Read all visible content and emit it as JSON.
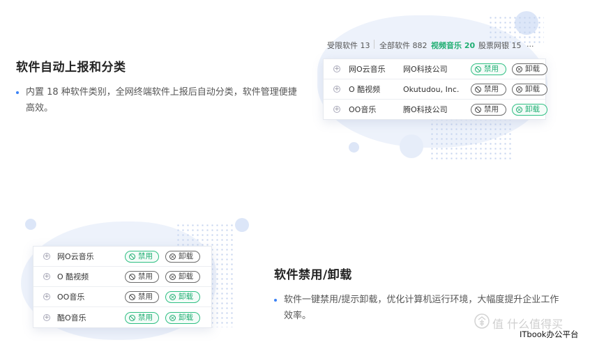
{
  "section1": {
    "heading": "软件自动上报和分类",
    "description": "内置 18 种软件类别，全网终端软件上报后自动分类，软件管理便捷高效。",
    "tabs": [
      {
        "label": "受限软件 13",
        "active": false
      },
      {
        "label": "全部软件 882",
        "active": false
      },
      {
        "label": "视频音乐 20",
        "active": true
      },
      {
        "label": "股票网银 15",
        "active": false
      },
      {
        "label": "...",
        "active": false
      }
    ],
    "rows": [
      {
        "name": "网O云音乐",
        "vendor": "网O科技公司",
        "disable": "禁用",
        "uninstall": "卸载",
        "disable_active": true,
        "uninstall_active": false
      },
      {
        "name": "O 酷视频",
        "vendor": "Okutudou, Inc.",
        "disable": "禁用",
        "uninstall": "卸载",
        "disable_active": false,
        "uninstall_active": false
      },
      {
        "name": "OO音乐",
        "vendor": "腾O科技公司",
        "disable": "禁用",
        "uninstall": "卸载",
        "disable_active": false,
        "uninstall_active": true
      }
    ]
  },
  "section2": {
    "heading": "软件禁用/卸载",
    "description": "软件一键禁用/提示卸载，优化计算机运行环境，大幅度提升企业工作效率。",
    "rows": [
      {
        "name": "网O云音乐",
        "disable": "禁用",
        "uninstall": "卸载",
        "disable_active": true,
        "uninstall_active": false
      },
      {
        "name": "O 酷视频",
        "disable": "禁用",
        "uninstall": "卸载",
        "disable_active": false,
        "uninstall_active": false
      },
      {
        "name": "OO音乐",
        "disable": "禁用",
        "uninstall": "卸载",
        "disable_active": false,
        "uninstall_active": true
      },
      {
        "name": "酷O音乐",
        "disable": "禁用",
        "uninstall": "卸载",
        "disable_active": true,
        "uninstall_active": true
      }
    ]
  },
  "watermark": "值 什么值得买",
  "credit": "ITbook办公平台",
  "colors": {
    "accent_green": "#1fae72",
    "bullet_blue": "#3b82f6",
    "blob_blue": "#e8effb"
  }
}
